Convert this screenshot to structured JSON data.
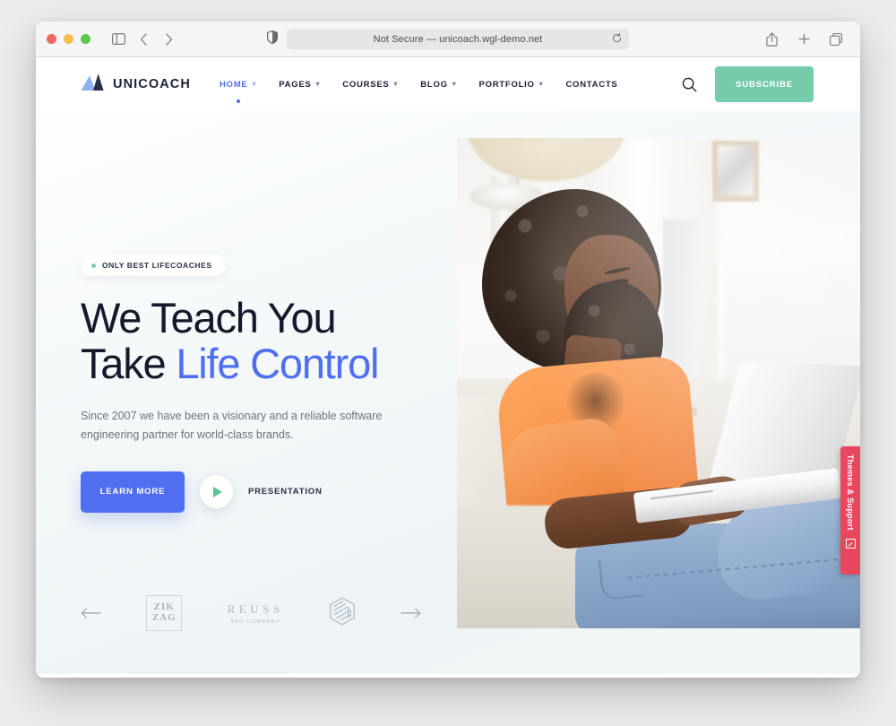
{
  "browser": {
    "url_text": "Not Secure — unicoach.wgl-demo.net",
    "traffic_lights": [
      "close-red",
      "minimize-yellow",
      "zoom-green"
    ],
    "icons": {
      "sidebar": "sidebar-toggle-icon",
      "back": "back-arrow-icon",
      "forward": "forward-arrow-icon",
      "shield": "privacy-shield-icon",
      "reload": "reload-icon",
      "share": "share-icon",
      "new_tab": "plus-icon",
      "tabs": "tab-overview-icon"
    }
  },
  "site": {
    "brand": {
      "name": "UNICOACH",
      "logo": "mountain-logo-icon"
    },
    "nav": [
      {
        "label": "HOME",
        "has_caret": true,
        "active": true
      },
      {
        "label": "PAGES",
        "has_caret": true,
        "active": false
      },
      {
        "label": "COURSES",
        "has_caret": true,
        "active": false
      },
      {
        "label": "BLOG",
        "has_caret": true,
        "active": false
      },
      {
        "label": "PORTFOLIO",
        "has_caret": true,
        "active": false
      },
      {
        "label": "CONTACTS",
        "has_caret": false,
        "active": false
      }
    ],
    "search_icon": "search-icon",
    "subscribe_label": "SUBSCRIBE",
    "colors": {
      "accent_blue": "#4f6ef0",
      "accent_green": "#74ccab",
      "heading_dark": "#121a2b",
      "support_red": "#e8475f"
    }
  },
  "hero": {
    "badge": "ONLY BEST LIFECOACHES",
    "title_line1": "We Teach You",
    "title_line2_plain": "Take ",
    "title_line2_accent": "Life Control",
    "subtitle": "Since 2007 we have been a visionary and a reliable software engineering partner for world-class brands.",
    "primary_cta": "LEARN MORE",
    "video_label": "PRESENTATION",
    "play_icon": "play-icon",
    "image_alt": "Smiling woman with curly hair using a laptop on a white sofa"
  },
  "brands": {
    "prev_icon": "arrow-left-icon",
    "next_icon": "arrow-right-icon",
    "items": [
      {
        "name": "ZIK ZAG",
        "line1": "ZIK",
        "line2": "ZAG",
        "type": "boxed-text"
      },
      {
        "name": "REUSS",
        "line1": "REUSS",
        "line2": "SEO COMPANY",
        "type": "text"
      },
      {
        "name": "Cube",
        "type": "cube-icon"
      }
    ]
  },
  "side_tab": {
    "label": "Themes & Support",
    "icon": "support-ticket-icon"
  }
}
